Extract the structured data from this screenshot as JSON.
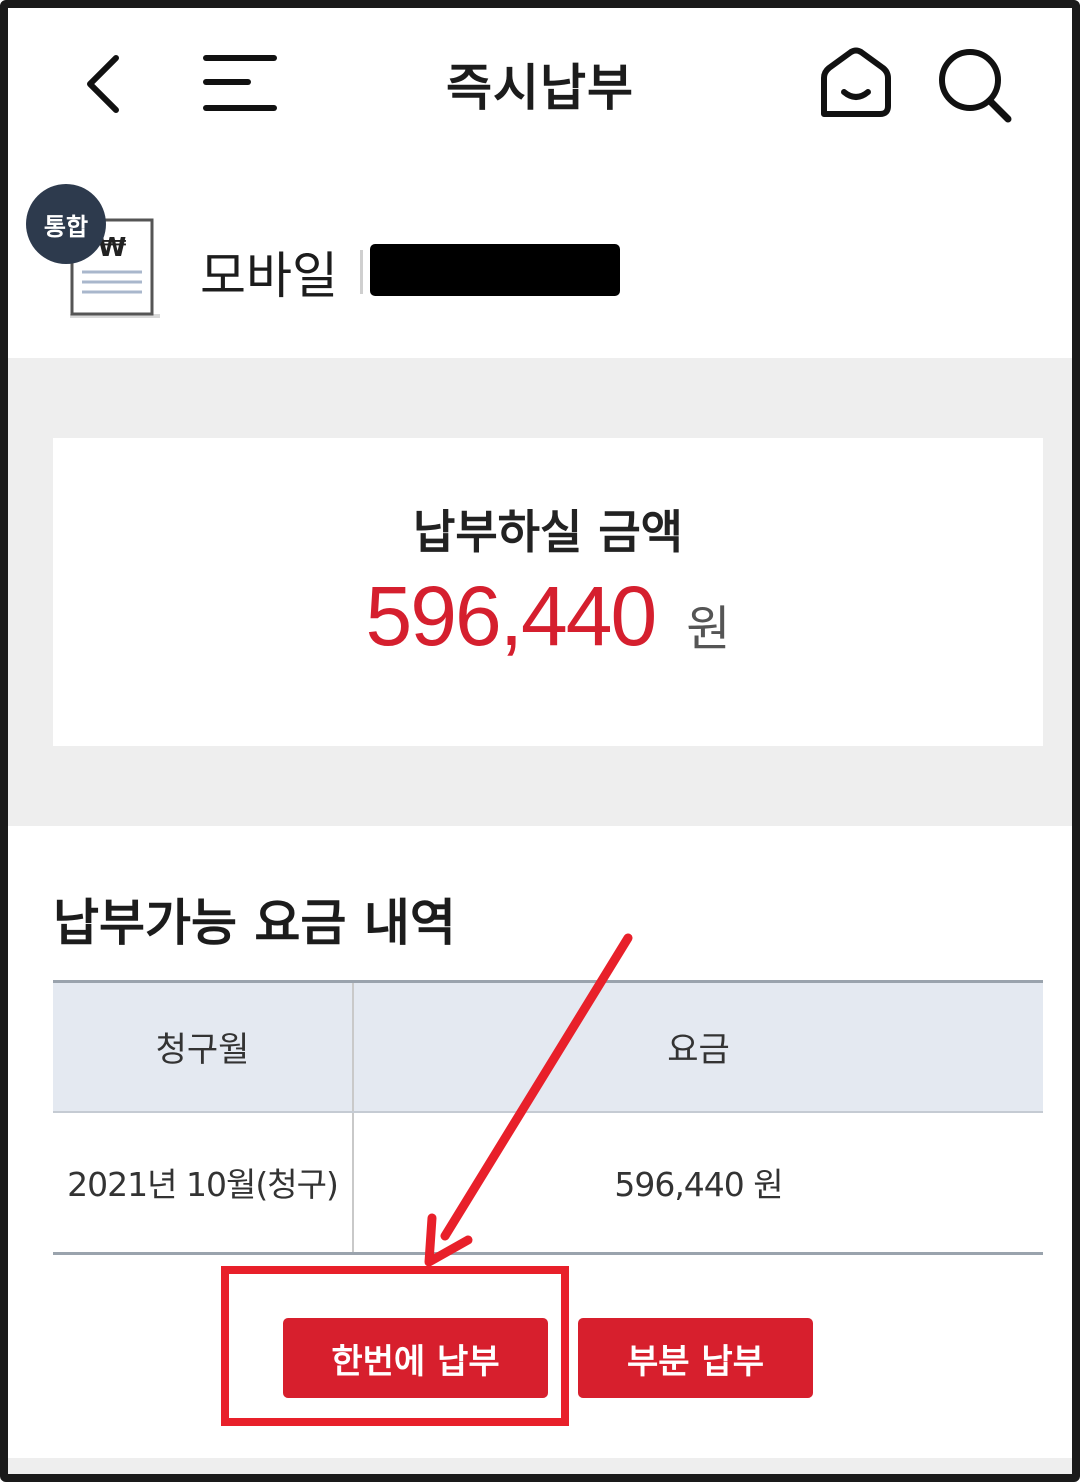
{
  "header": {
    "title": "즉시납부",
    "icons": [
      "back-icon",
      "menu-icon",
      "home-icon",
      "search-icon"
    ]
  },
  "account": {
    "badge": "통합",
    "type_label": "모바일",
    "number_redacted": true
  },
  "amount": {
    "title": "납부하실 금액",
    "value": "596,440",
    "unit": "원",
    "color": "#d51f2e"
  },
  "charges": {
    "section_title": "납부가능 요금 내역",
    "columns": [
      "청구월",
      "요금"
    ],
    "rows": [
      {
        "month": "2021년 10월(청구)",
        "amount": "596,440 원"
      }
    ]
  },
  "buttons": {
    "pay_full": "한번에 납부",
    "pay_partial": "부분 납부",
    "color": "#d71f2d"
  },
  "annotation": {
    "color": "#e8202a",
    "highlights": "pay_full"
  }
}
